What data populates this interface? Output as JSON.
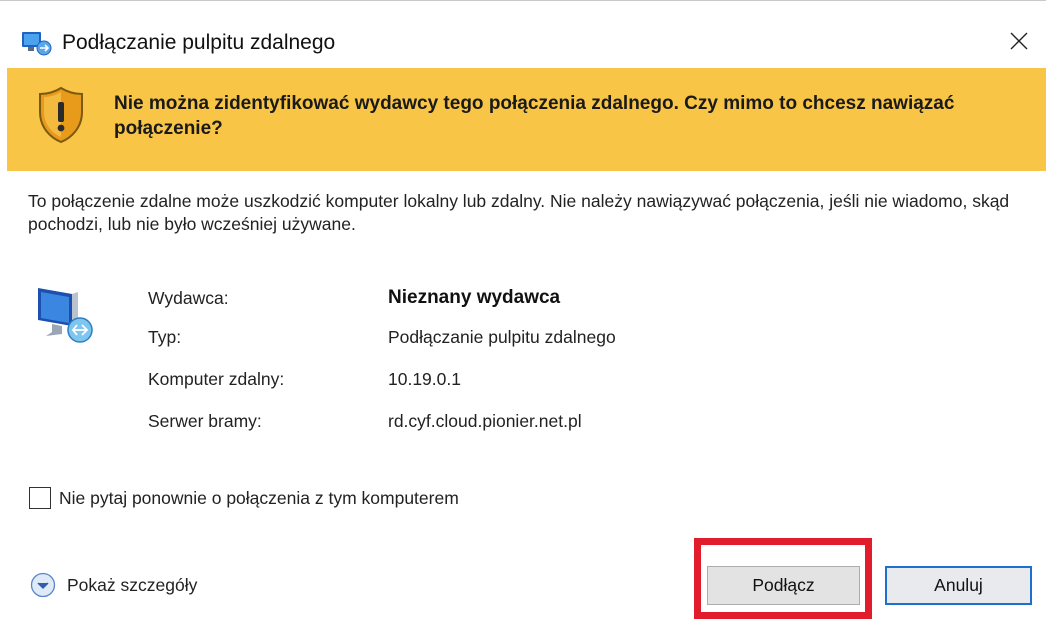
{
  "window": {
    "title": "Podłączanie pulpitu zdalnego",
    "icon": "remote-desktop-icon",
    "close_icon": "close-icon"
  },
  "banner": {
    "icon": "shield-warning-icon",
    "text": "Nie można zidentyfikować wydawcy tego połączenia zdalnego. Czy mimo to chcesz nawiązać połączenie?",
    "background": "#f8c546"
  },
  "description": "To połączenie zdalne może uszkodzić komputer lokalny lub zdalny. Nie należy nawiązywać połączenia, jeśli nie wiadomo, skąd pochodzi, lub nie było wcześniej używane.",
  "info": {
    "icon": "remote-computer-icon",
    "rows": [
      {
        "label": "Wydawca:",
        "value": "Nieznany wydawca"
      },
      {
        "label": "Typ:",
        "value": "Podłączanie pulpitu zdalnego"
      },
      {
        "label": "Komputer zdalny:",
        "value": "10.19.0.1"
      },
      {
        "label": "Serwer bramy:",
        "value": "rd.cyf.cloud.pionier.net.pl"
      }
    ]
  },
  "checkbox": {
    "label": "Nie pytaj ponownie o połączenia z tym komputerem",
    "checked": false
  },
  "details": {
    "label": "Pokaż szczegóły",
    "icon": "chevron-down-circle-icon"
  },
  "buttons": {
    "connect": "Podłącz",
    "cancel": "Anuluj"
  },
  "colors": {
    "highlight": "#e11d2d",
    "focus_border": "#1f6fd1"
  }
}
